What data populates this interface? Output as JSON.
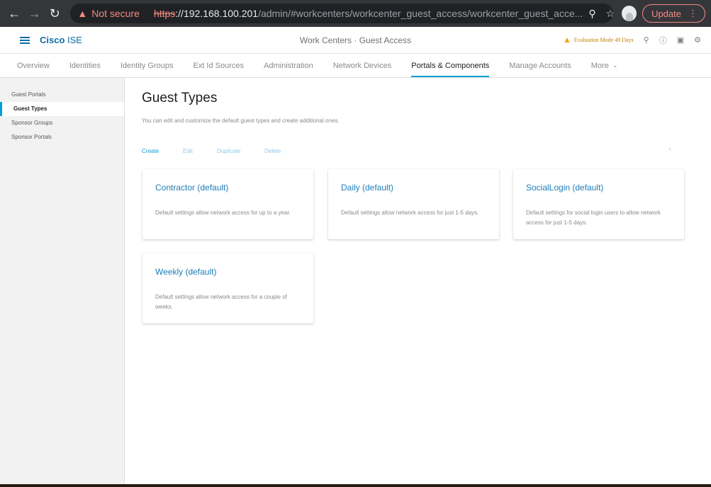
{
  "browser": {
    "back_icon": "arrow-left-icon",
    "forward_icon": "arrow-right-icon",
    "reload_icon": "reload-icon",
    "security_label": "Not secure",
    "url_scheme": "https",
    "url_host": "://192.168.100.201",
    "url_path": "/admin/#workcenters/workcenter_guest_access/workcenter_guest_acce...",
    "update_label": "Update"
  },
  "header": {
    "brand_bold": "Cisco",
    "brand_light": " ISE",
    "title": "Work Centers · Guest Access",
    "eval_text": "Evaluation Mode 49 Days"
  },
  "tabs": [
    {
      "label": "Overview"
    },
    {
      "label": "Identities"
    },
    {
      "label": "Identity Groups"
    },
    {
      "label": "Ext Id Sources"
    },
    {
      "label": "Administration"
    },
    {
      "label": "Network Devices"
    },
    {
      "label": "Portals & Components"
    },
    {
      "label": "Manage Accounts"
    },
    {
      "label": "More"
    }
  ],
  "sidebar": {
    "items": [
      {
        "label": "Guest Portals"
      },
      {
        "label": "Guest Types"
      },
      {
        "label": "Sponsor Groups"
      },
      {
        "label": "Sponsor Portals"
      }
    ]
  },
  "main": {
    "title": "Guest Types",
    "description": "You can edit and customize the default guest types and create additional ones.",
    "actions": {
      "create": "Create",
      "edit": "Edit",
      "duplicate": "Duplicate",
      "delete": "Delete"
    },
    "close_glyph": "×",
    "cards": [
      {
        "title": "Contractor (default)",
        "description": "Default settings allow network access for up to a year."
      },
      {
        "title": "Daily (default)",
        "description": "Default settings allow network access for just 1-5 days."
      },
      {
        "title": "SocialLogin (default)",
        "description": "Default settings for social login users to allow network access for just 1-5 days."
      },
      {
        "title": "Weekly (default)",
        "description": "Default settings allow network access for a couple of weeks."
      }
    ]
  },
  "colors": {
    "accent": "#049fd9",
    "link": "#1c7db8",
    "warning": "#f0a30a"
  }
}
